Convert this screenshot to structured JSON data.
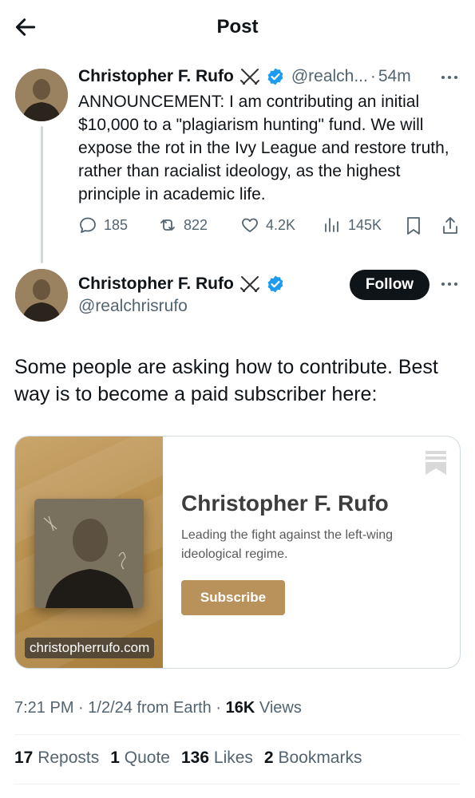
{
  "header": {
    "title": "Post",
    "back_icon": "arrow-left-icon"
  },
  "parent_tweet": {
    "author_name": "Christopher F. Rufo",
    "handle": "@realch...",
    "separator": "·",
    "time": "54m",
    "text": "ANNOUNCEMENT: I am contributing an initial $10,000 to a \"plagiarism hunting\" fund. We will expose the rot in the Ivy League and restore truth, rather than racialist ideology, as the highest principle in academic life.",
    "actions": {
      "replies": "185",
      "reposts": "822",
      "likes": "4.2K",
      "views": "145K"
    }
  },
  "main_tweet": {
    "author_name": "Christopher F. Rufo",
    "handle": "@realchrisrufo",
    "follow_label": "Follow",
    "text": "Some people are asking how to contribute. Best way is to become a paid subscriber here:",
    "card": {
      "title": "Christopher F. Rufo",
      "description": "Leading the fight against the left-wing ideological regime.",
      "button_label": "Subscribe",
      "domain": "christopherrufo.com",
      "accent_color": "#b8925a"
    },
    "meta": {
      "time": "7:21 PM",
      "date": "1/2/24",
      "source": "from Earth",
      "views_count": "16K",
      "views_label": "Views"
    },
    "stats": {
      "reposts_count": "17",
      "reposts_label": "Reposts",
      "quotes_count": "1",
      "quotes_label": "Quote",
      "likes_count": "136",
      "likes_label": "Likes",
      "bookmarks_count": "2",
      "bookmarks_label": "Bookmarks"
    }
  },
  "colors": {
    "verified": "#1d9bf0",
    "text": "#0f1419",
    "secondary": "#536471",
    "follow_bg": "#0f1419"
  }
}
